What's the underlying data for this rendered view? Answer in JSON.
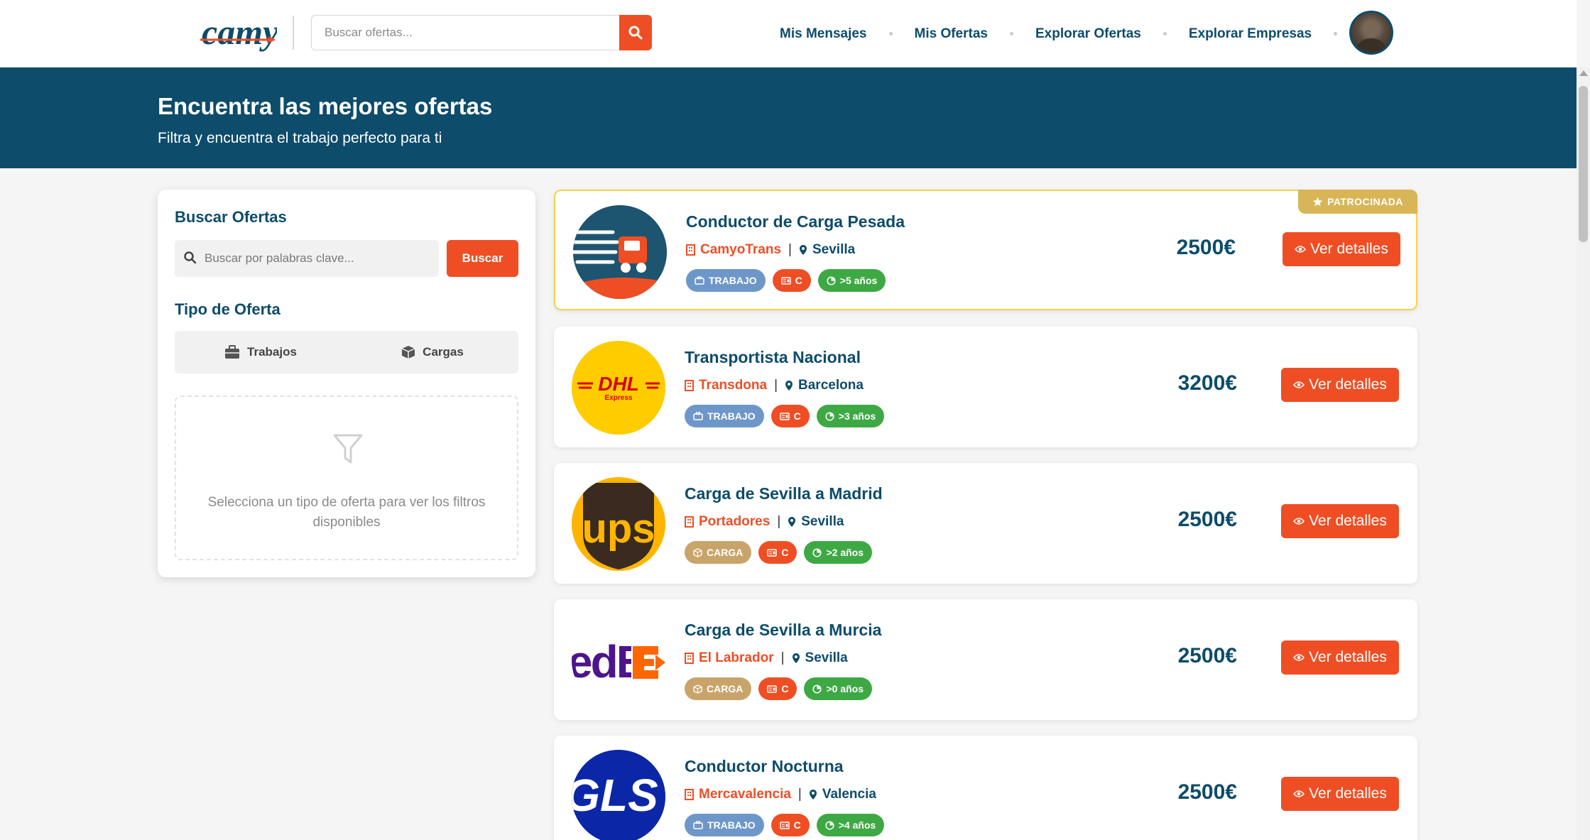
{
  "nav": {
    "logo_text": "camyo",
    "search_placeholder": "Buscar ofertas...",
    "links": [
      {
        "label": "Mis Mensajes"
      },
      {
        "label": "Mis Ofertas"
      },
      {
        "label": "Explorar Ofertas"
      },
      {
        "label": "Explorar Empresas"
      }
    ],
    "avatar_icon": "user-avatar"
  },
  "hero": {
    "title": "Encuentra las mejores ofertas",
    "subtitle": "Filtra y encuentra el trabajo perfecto para ti"
  },
  "sidebar": {
    "search_title": "Buscar Ofertas",
    "keyword_placeholder": "Buscar por palabras clave...",
    "search_button": "Buscar",
    "type_title": "Tipo de Oferta",
    "types": [
      {
        "label": "Trabajos",
        "icon": "briefcase-icon"
      },
      {
        "label": "Cargas",
        "icon": "box-icon"
      }
    ],
    "empty_text": "Selecciona un tipo de oferta para ver los filtros disponibles"
  },
  "offers": [
    {
      "title": "Conductor de Carga Pesada",
      "company": "CamyoTrans",
      "location": "Sevilla",
      "type": "TRABAJO",
      "license": "C",
      "experience": ">5 años",
      "price": "2500€",
      "button": "Ver detalles",
      "sponsored_label": "PATROCINADA",
      "logo": "truck-logo"
    },
    {
      "title": "Transportista Nacional",
      "company": "Transdona",
      "location": "Barcelona",
      "type": "TRABAJO",
      "license": "C",
      "experience": ">3 años",
      "price": "3200€",
      "button": "Ver detalles",
      "logo": "dhl-logo",
      "logo_text": "DHL",
      "logo_subtext": "Express"
    },
    {
      "title": "Carga de Sevilla a Madrid",
      "company": "Portadores",
      "location": "Sevilla",
      "type": "CARGA",
      "license": "C",
      "experience": ">2 años",
      "price": "2500€",
      "button": "Ver detalles",
      "logo": "ups-logo",
      "logo_text": "ups"
    },
    {
      "title": "Carga de Sevilla a Murcia",
      "company": "El Labrador",
      "location": "Sevilla",
      "type": "CARGA",
      "license": "C",
      "experience": ">0 años",
      "price": "2500€",
      "button": "Ver detalles",
      "logo": "fedex-logo",
      "logo_text": "edE"
    },
    {
      "title": "Conductor Nocturna",
      "company": "Mercavalencia",
      "location": "Valencia",
      "type": "TRABAJO",
      "license": "C",
      "experience": ">4 años",
      "price": "2500€",
      "button": "Ver detalles",
      "logo": "gls-logo",
      "logo_text": "GLS"
    }
  ],
  "colors": {
    "primary": "#0d4c6b",
    "accent": "#ef4e24",
    "trabajo_badge": "#6e97c9",
    "carga_badge": "#c9a46a",
    "experience_badge": "#3ea944",
    "sponsored": "#d8b658"
  }
}
